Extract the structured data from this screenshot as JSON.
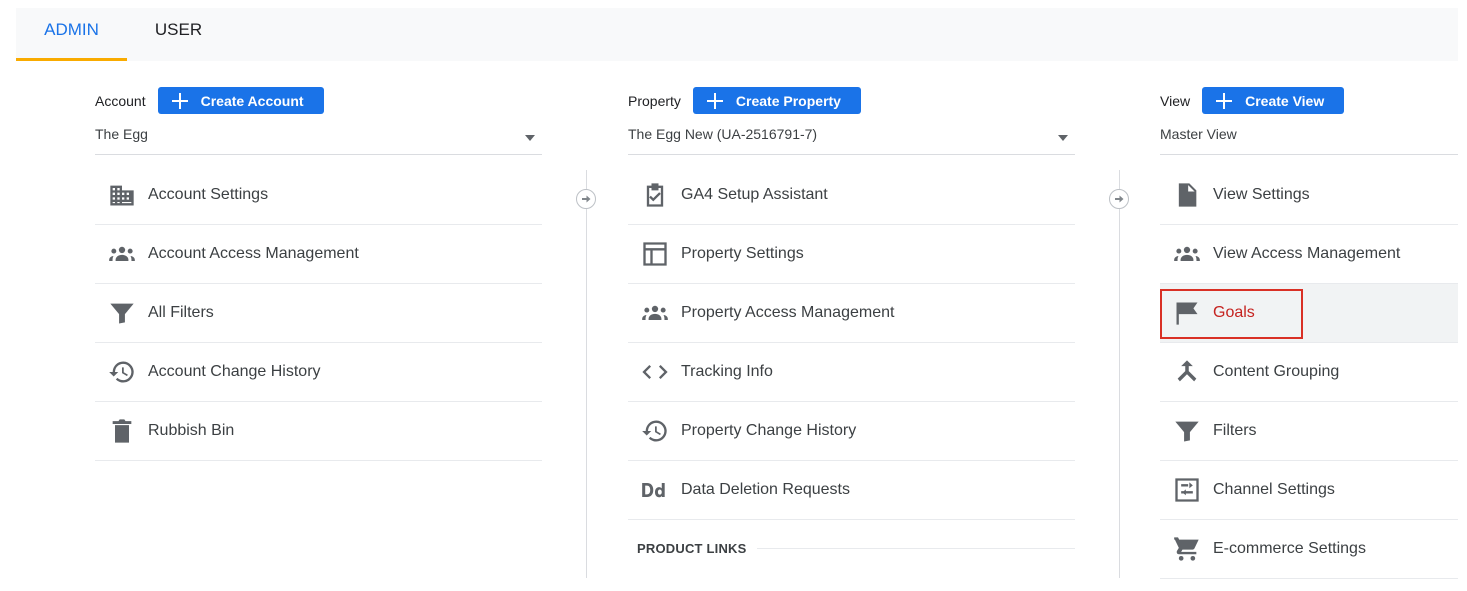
{
  "tabs": {
    "admin": "ADMIN",
    "user": "USER"
  },
  "account": {
    "label": "Account",
    "create_label": "Create Account",
    "selected": "The Egg",
    "items": [
      {
        "label": "Account Settings",
        "icon": "building-icon"
      },
      {
        "label": "Account Access Management",
        "icon": "people-icon"
      },
      {
        "label": "All Filters",
        "icon": "filter-icon"
      },
      {
        "label": "Account Change History",
        "icon": "history-icon"
      },
      {
        "label": "Rubbish Bin",
        "icon": "trash-icon"
      }
    ]
  },
  "property": {
    "label": "Property",
    "create_label": "Create Property",
    "selected": "The Egg New (UA-2516791-7)",
    "items": [
      {
        "label": "GA4 Setup Assistant",
        "icon": "clipboard-check-icon"
      },
      {
        "label": "Property Settings",
        "icon": "layout-icon"
      },
      {
        "label": "Property Access Management",
        "icon": "people-icon"
      },
      {
        "label": "Tracking Info",
        "icon": "code-icon"
      },
      {
        "label": "Property Change History",
        "icon": "history-icon"
      },
      {
        "label": "Data Deletion Requests",
        "icon": "dd-icon"
      }
    ],
    "section_header": "PRODUCT LINKS"
  },
  "view": {
    "label": "View",
    "create_label": "Create View",
    "selected": "Master View",
    "items": [
      {
        "label": "View Settings",
        "icon": "document-icon"
      },
      {
        "label": "View Access Management",
        "icon": "people-icon"
      },
      {
        "label": "Goals",
        "icon": "flag-icon",
        "highlighted": true
      },
      {
        "label": "Content Grouping",
        "icon": "merge-icon"
      },
      {
        "label": "Filters",
        "icon": "filter-icon"
      },
      {
        "label": "Channel Settings",
        "icon": "channel-icon"
      },
      {
        "label": "E-commerce Settings",
        "icon": "cart-icon"
      }
    ]
  },
  "colors": {
    "accent": "#1a73e8",
    "tab_underline": "#f9ab00",
    "highlight_border": "#d93025"
  }
}
